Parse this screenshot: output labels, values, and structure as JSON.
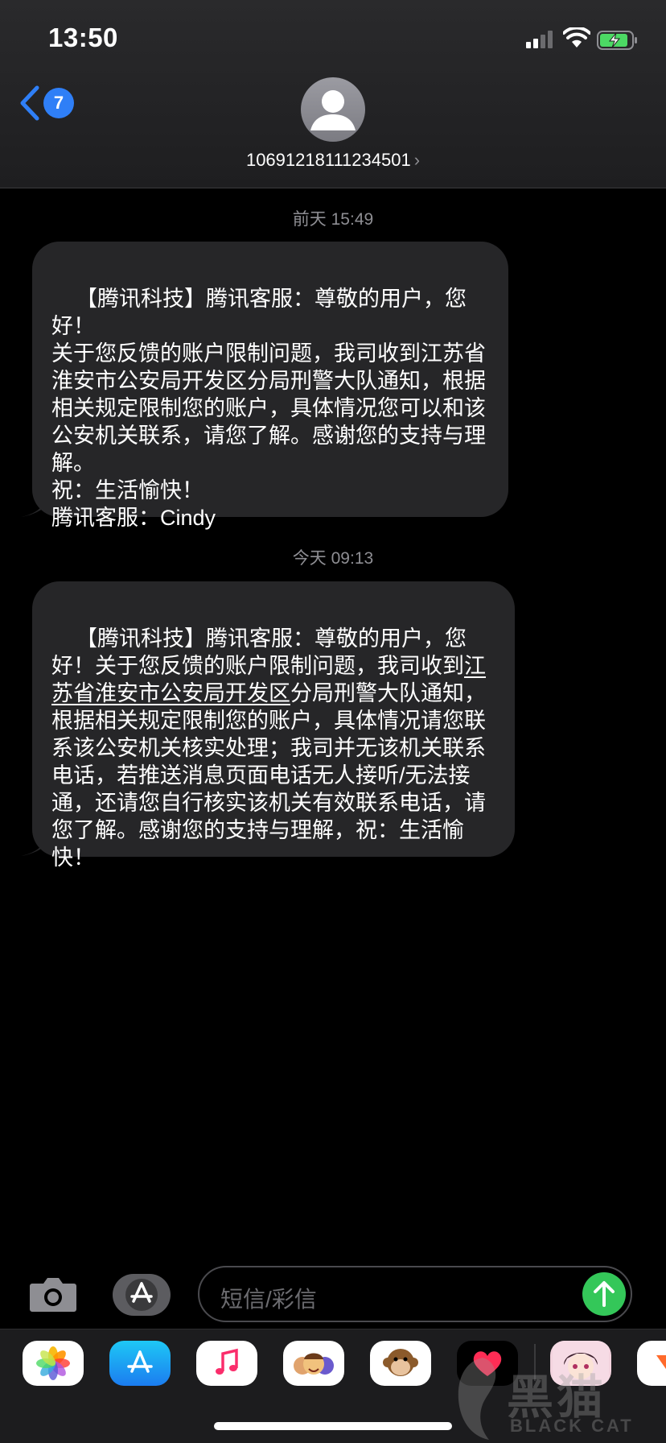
{
  "status_bar": {
    "time": "13:50"
  },
  "header": {
    "back_badge_count": "7",
    "contact_number": "10691218111234501",
    "contact_chevron": "›"
  },
  "messages": [
    {
      "timestamp": "前天 15:49",
      "text_before": "【腾讯科技】腾讯客服：尊敬的用户，您好！\n关于您反馈的账户限制问题，我司收到江苏省淮安市公安局开发区分局刑警大队通知，根据相关规定限制您的账户，具体情况您可以和该公安机关联系，请您了解。感谢您的支持与理解。\n祝：生活愉快！\n腾讯客服：Cindy"
    },
    {
      "timestamp": "今天 09:13",
      "text_before": "【腾讯科技】腾讯客服：尊敬的用户，您好！关于您反馈的账户限制问题，我司收到",
      "text_link": "江苏省淮安市公安局开发区",
      "text_after": "分局刑警大队通知，根据相关规定限制您的账户，具体情况请您联系该公安机关核实处理；我司并无该机关联系电话，若推送消息页面电话无人接听/无法接通，还请您自行核实该机关有效联系电话，请您了解。感谢您的支持与理解，祝：生活愉快！"
    }
  ],
  "input_bar": {
    "placeholder": "短信/彩信"
  },
  "drawer": {
    "apps": [
      "photos-icon",
      "app-store-icon",
      "music-icon",
      "memoji-icon",
      "animoji-monkey-icon",
      "digital-touch-icon",
      "sticker-icon",
      "sticker-icon-2"
    ]
  },
  "watermark": {
    "text": "黑猫",
    "sub": "BLACK CAT"
  },
  "colors": {
    "bubble": "#262628",
    "accent": "#2f7ff7",
    "send": "#34c759"
  }
}
